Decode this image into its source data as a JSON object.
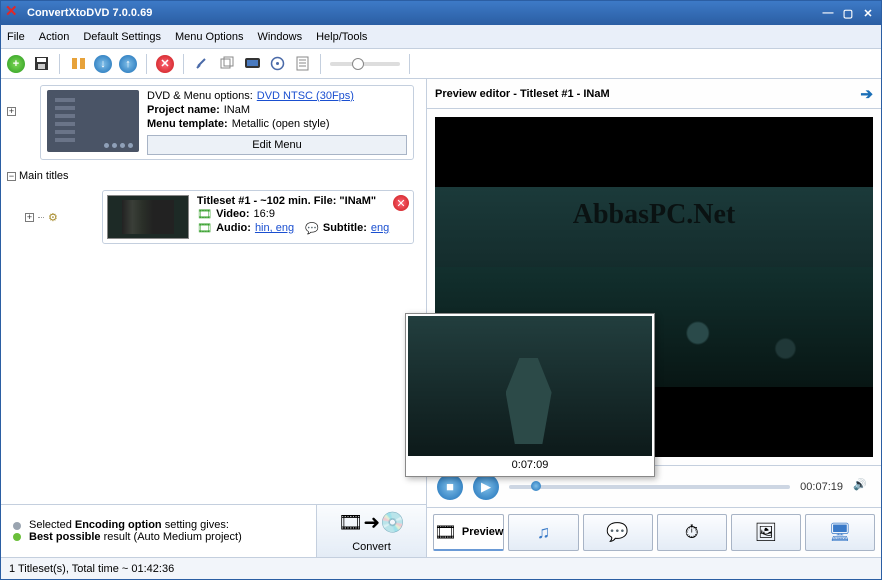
{
  "app": {
    "title": "ConvertXtoDVD 7.0.0.69"
  },
  "menu": [
    "File",
    "Action",
    "Default Settings",
    "Menu Options",
    "Windows",
    "Help/Tools"
  ],
  "project": {
    "options_label": "DVD & Menu options:",
    "options_link": "DVD NTSC (30Fps)",
    "name_label": "Project name:",
    "name_value": "INaM",
    "template_label": "Menu template:",
    "template_value": "Metallic (open style)",
    "edit_menu": "Edit Menu"
  },
  "tree": {
    "main_titles": "Main titles",
    "titleset": {
      "heading": "Titleset #1 - ~102 min. File: \"INaM\"",
      "video_label": "Video:",
      "video_value": "16:9",
      "audio_label": "Audio:",
      "audio_value": "hin, eng",
      "subtitle_label": "Subtitle:",
      "subtitle_value": "eng"
    }
  },
  "encoding_line1a": "Selected ",
  "encoding_line1b": "Encoding option",
  "encoding_line1c": " setting gives:",
  "encoding_line2a": "Best possible",
  "encoding_line2b": " result (Auto Medium project)",
  "convert": "Convert",
  "status": "1 Titleset(s), Total time ~ 01:42:36",
  "preview": {
    "header": "Preview editor - Titleset #1 - INaM",
    "watermark": "AbbasPC.Net",
    "popup_time": "0:07:09",
    "play_time": "00:07:19"
  },
  "tabs": {
    "preview": "Preview"
  }
}
